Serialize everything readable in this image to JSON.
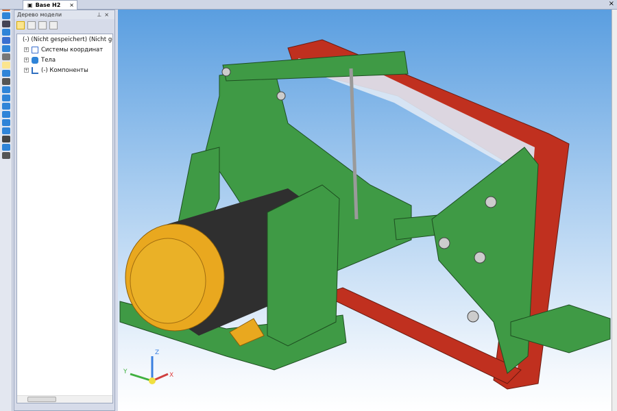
{
  "tab": {
    "label": "Base H2",
    "close": "×"
  },
  "window_close": "×",
  "panel": {
    "title": "Дерево модели",
    "pin": "⊥",
    "close": "×"
  },
  "tree": [
    {
      "label": "(-) (Nicht gespeichert) (Nicht gespeichert)",
      "expander": ""
    },
    {
      "label": "Системы координат",
      "expander": "+"
    },
    {
      "label": "Тела",
      "expander": "+"
    },
    {
      "label": "(-) Компоненты",
      "expander": "+"
    }
  ],
  "axes": {
    "x": "X",
    "y": "Y",
    "z": "Z"
  },
  "colors": {
    "frame": "#3f9a45",
    "belt": "#c0301f",
    "motor": "#2f2f2f",
    "cap": "#e9a81f"
  }
}
